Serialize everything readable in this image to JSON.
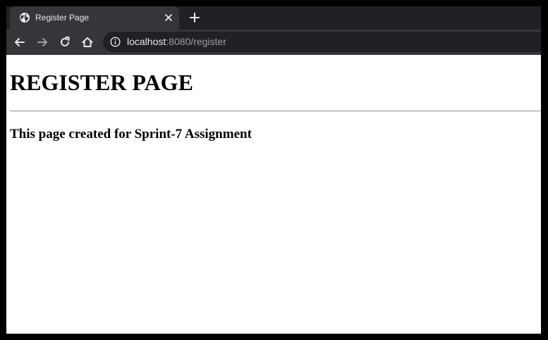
{
  "browser": {
    "tab": {
      "title": "Register Page",
      "favicon_icon": "globe-icon",
      "close_icon": "close-icon"
    },
    "new_tab_icon": "plus-icon",
    "toolbar": {
      "back_icon": "arrow-left-icon",
      "forward_icon": "arrow-right-icon",
      "reload_icon": "reload-icon",
      "home_icon": "home-icon",
      "site_info_icon": "info-icon"
    },
    "address": {
      "host": "localhost",
      "rest": ":8080/register"
    },
    "colors": {
      "tabstrip": "#202124",
      "toolbar": "#35363a",
      "omnibox": "#202124",
      "text_primary": "#e8eaed",
      "text_secondary": "#9aa0a6"
    }
  },
  "page": {
    "heading": "REGISTER PAGE",
    "subheading": "This page created for Sprint-7 Assignment"
  }
}
